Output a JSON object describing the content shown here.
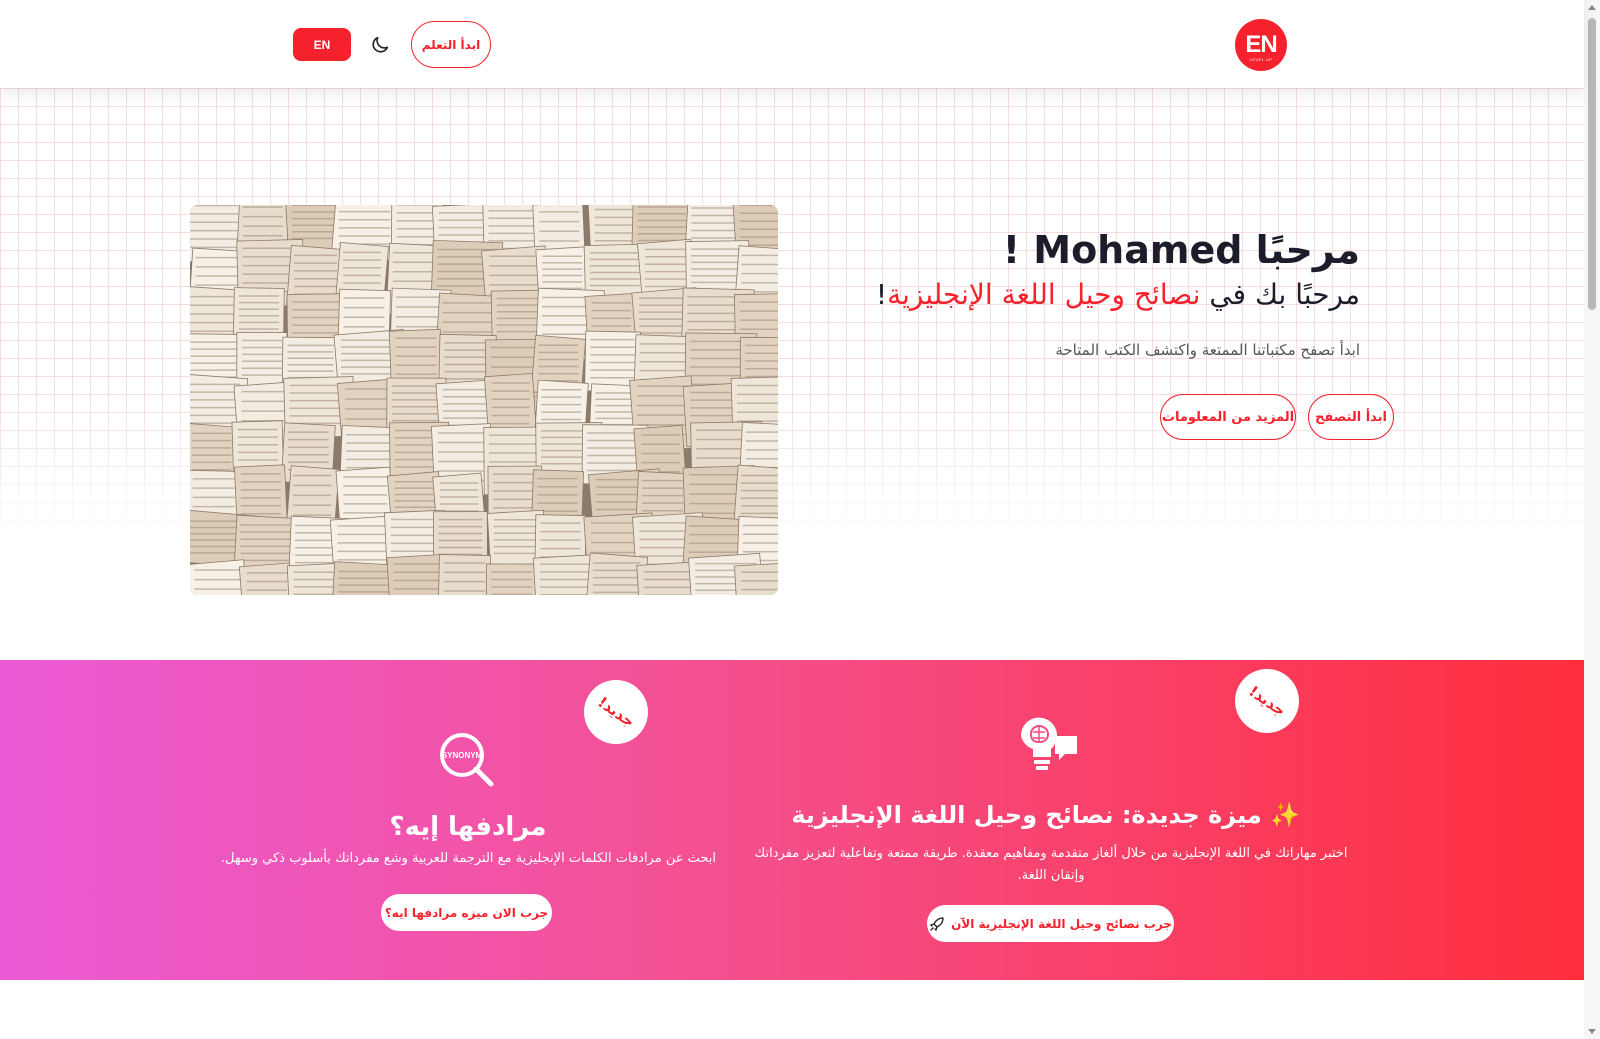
{
  "header": {
    "logo_text": "EN",
    "logo_subtext": "LEVEL UP",
    "start_learning_label": "ابدأ التعلم",
    "theme_icon": "moon-icon",
    "language_label": "EN"
  },
  "hero": {
    "title": "مرحبًا Mohamed !",
    "subtitle_prefix": "مرحبًا بك في ",
    "subtitle_accent": "نصائح وحيل اللغة الإنجليزية",
    "subtitle_suffix": "!",
    "description": "ابدأ تصفح مكتباتنا الممتعة واكتشف الكتب المتاحة",
    "browse_label": "ابدأ التصفح",
    "more_info_label": "المزيد من المعلومات",
    "image_icon": "open-books-image"
  },
  "features": [
    {
      "badge": "جديد!",
      "icon": "synonym-magnifier-icon",
      "icon_text": "SYNONYM",
      "title": "مرادفها إيه؟",
      "description": "ابحث عن مرادفات الكلمات الإنجليزية مع الترجمة للعربية وشع مفرداتك بأسلوب ذكي وسهل.",
      "button_label": "جرب الان ميزه مرادفها ايه؟"
    },
    {
      "badge": "جديد!",
      "icon": "brain-lightbulb-chat-icon",
      "title_emoji": "✨",
      "title": "ميزة جديدة: نصائح وحيل اللغة الإنجليزية",
      "description": "اختبر مهاراتك في اللغة الإنجليزية من خلال ألغاز متقدمة ومفاهيم معقدة. طريقة ممتعة وتفاعلية لتعزيز مفرداتك وإتقان اللغة.",
      "button_icon": "rocket-icon",
      "button_label": "جرب نصائح وحيل اللغة الإنجليزية الآن"
    }
  ],
  "colors": {
    "accent": "#f5222d",
    "gradient_start": "#ec5ad7",
    "gradient_end": "#ff2e3c"
  }
}
